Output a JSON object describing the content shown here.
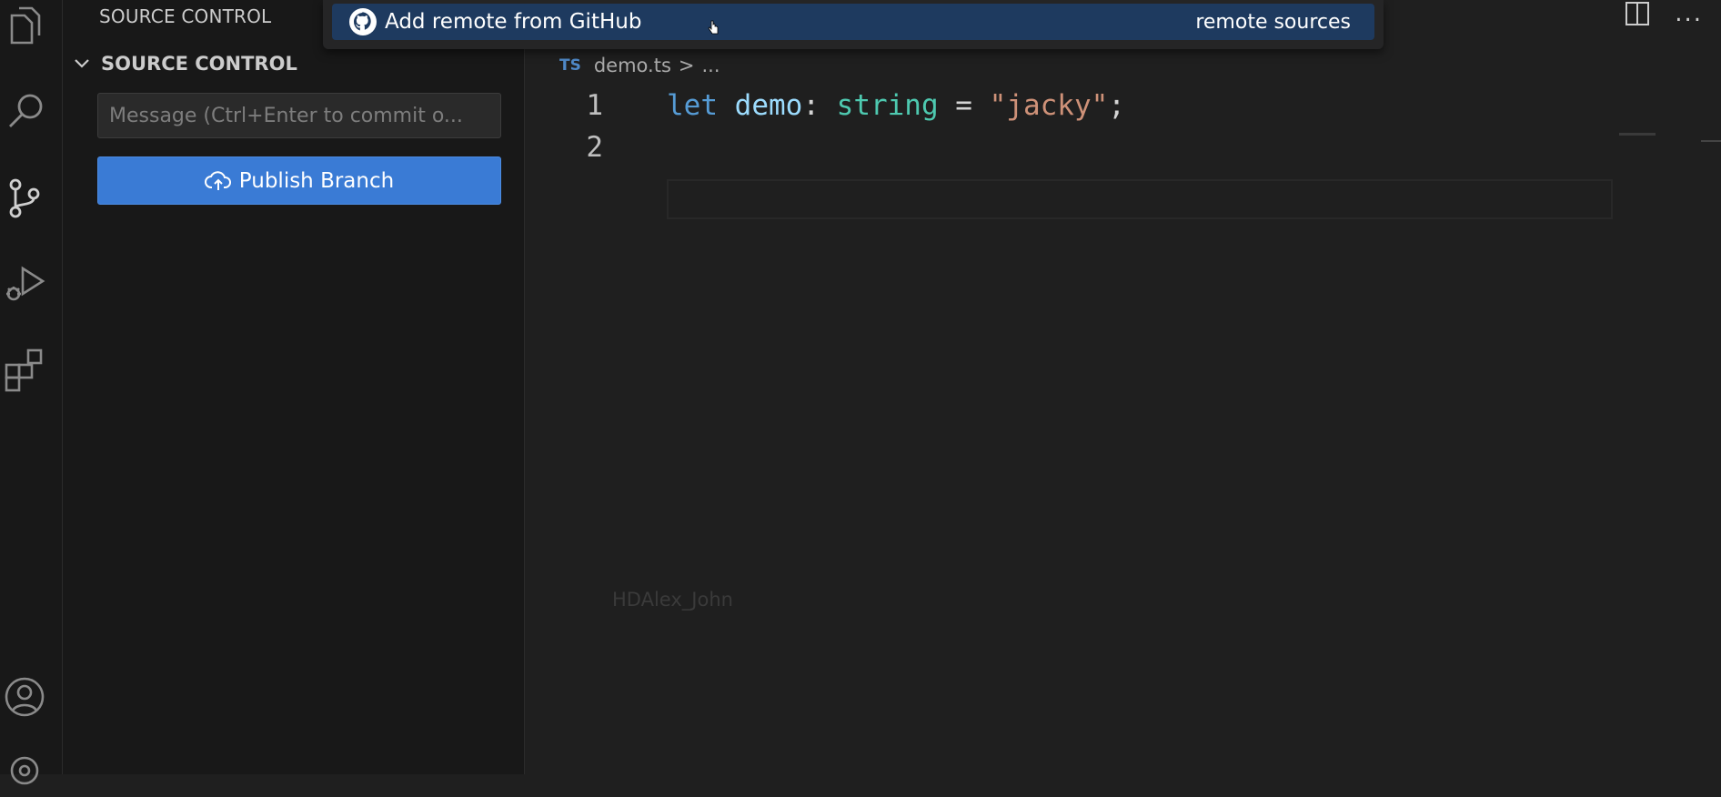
{
  "sidebar": {
    "title": "SOURCE CONTROL",
    "section_title": "SOURCE CONTROL",
    "commit_placeholder": "Message (Ctrl+Enter to commit o...",
    "publish_label": "Publish Branch"
  },
  "quick_pick": {
    "item_label": "Add remote from GitHub",
    "item_description": "remote sources"
  },
  "editor": {
    "breadcrumb": {
      "lang_badge": "TS",
      "file": "demo.ts",
      "separator": ">",
      "rest": "..."
    },
    "lines": [
      {
        "number": "1",
        "tokens": {
          "keyword": "let",
          "space1": " ",
          "identifier": "demo",
          "colon": ": ",
          "type": "string",
          "eq": " = ",
          "string": "\"jacky\"",
          "semi": ";"
        }
      },
      {
        "number": "2"
      }
    ],
    "watermark": "HDAlex_John"
  },
  "titlebar": {
    "more": "..."
  },
  "icons": {
    "activity": [
      "explorer-icon",
      "search-icon",
      "source-control-icon",
      "run-debug-icon",
      "extensions-icon",
      "account-icon",
      "settings-gear-icon"
    ],
    "publish": "cloud-upload-icon",
    "quick_pick": "github-icon",
    "section": "chevron-down-icon"
  },
  "colors": {
    "accent": "#3a7bd5",
    "quick_pick_selected": "#1e3a5f",
    "keyword": "#569cd6",
    "identifier": "#9cdcfe",
    "type": "#4ec9b0",
    "string": "#ce9178"
  }
}
